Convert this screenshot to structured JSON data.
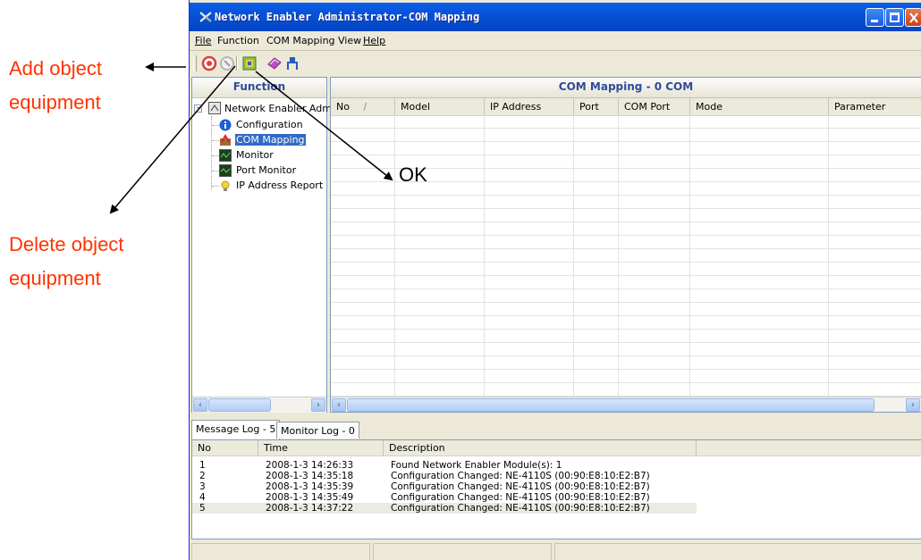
{
  "annotations": {
    "add_line1": "Add object",
    "add_line2": "equipment",
    "delete_line1": "Delete object",
    "delete_line2": "equipment",
    "ok": "OK",
    "color": "#ff3300"
  },
  "window": {
    "title": "Network Enabler Administrator-COM Mapping",
    "titlebar_color": "#0652d8"
  },
  "menu": {
    "file": "File",
    "function": "Function",
    "com_mapping": "COM Mapping",
    "view": "View",
    "help": "Help"
  },
  "toolbar": {
    "icons": [
      "add-icon",
      "delete-icon",
      "ok-apply-icon",
      "settings-icon",
      "connect-icon"
    ]
  },
  "left_pane": {
    "header": "Function",
    "root": "Network Enabler Admin",
    "items": [
      {
        "label": "Configuration",
        "icon": "info-icon"
      },
      {
        "label": "COM Mapping",
        "icon": "com-mapping-icon",
        "selected": true
      },
      {
        "label": "Monitor",
        "icon": "monitor-icon"
      },
      {
        "label": "Port Monitor",
        "icon": "port-monitor-icon"
      },
      {
        "label": "IP Address Report",
        "icon": "bulb-icon"
      }
    ]
  },
  "main": {
    "header": "COM Mapping - 0 COM",
    "columns": [
      "No",
      "Model",
      "IP Address",
      "Port",
      "COM Port",
      "Mode",
      "Parameter"
    ],
    "sort_indicator": "/",
    "accent": "#2f4a9c"
  },
  "log": {
    "tabs": [
      "Message Log - 5",
      "Monitor Log - 0"
    ],
    "columns": [
      "No",
      "Time",
      "Description"
    ],
    "rows": [
      {
        "no": "1",
        "time": "2008-1-3 14:26:33",
        "description": "Found Network Enabler Module(s): 1"
      },
      {
        "no": "2",
        "time": "2008-1-3 14:35:18",
        "description": "Configuration Changed: NE-4110S (00:90:E8:10:E2:B7)"
      },
      {
        "no": "3",
        "time": "2008-1-3 14:35:39",
        "description": "Configuration Changed: NE-4110S (00:90:E8:10:E2:B7)"
      },
      {
        "no": "4",
        "time": "2008-1-3 14:35:49",
        "description": "Configuration Changed: NE-4110S (00:90:E8:10:E2:B7)"
      },
      {
        "no": "5",
        "time": "2008-1-3 14:37:22",
        "description": "Configuration Changed: NE-4110S (00:90:E8:10:E2:B7)"
      }
    ]
  }
}
